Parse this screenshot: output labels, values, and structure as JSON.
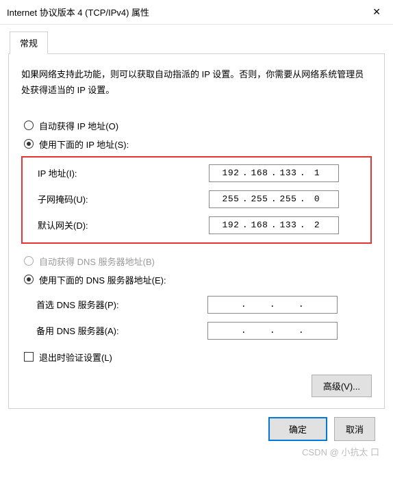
{
  "title": "Internet 协议版本 4 (TCP/IPv4) 属性",
  "tab": {
    "general": "常规"
  },
  "desc": "如果网络支持此功能，则可以获取自动指派的 IP 设置。否则，你需要从网络系统管理员处获得适当的 IP 设置。",
  "ip": {
    "auto": "自动获得 IP 地址(O)",
    "manual": "使用下面的 IP 地址(S):",
    "addr_label": "IP 地址(I):",
    "mask_label": "子网掩码(U):",
    "gw_label": "默认网关(D):",
    "addr": [
      "192",
      "168",
      "133",
      "1"
    ],
    "mask": [
      "255",
      "255",
      "255",
      "0"
    ],
    "gw": [
      "192",
      "168",
      "133",
      "2"
    ]
  },
  "dns": {
    "auto": "自动获得 DNS 服务器地址(B)",
    "manual": "使用下面的 DNS 服务器地址(E):",
    "pref_label": "首选 DNS 服务器(P):",
    "alt_label": "备用 DNS 服务器(A):",
    "pref": [
      "",
      "",
      "",
      ""
    ],
    "alt": [
      "",
      "",
      "",
      ""
    ]
  },
  "validate": "退出时验证设置(L)",
  "buttons": {
    "advanced": "高级(V)...",
    "ok": "确定",
    "cancel": "取消"
  },
  "watermark": "CSDN @ 小抗太 口"
}
